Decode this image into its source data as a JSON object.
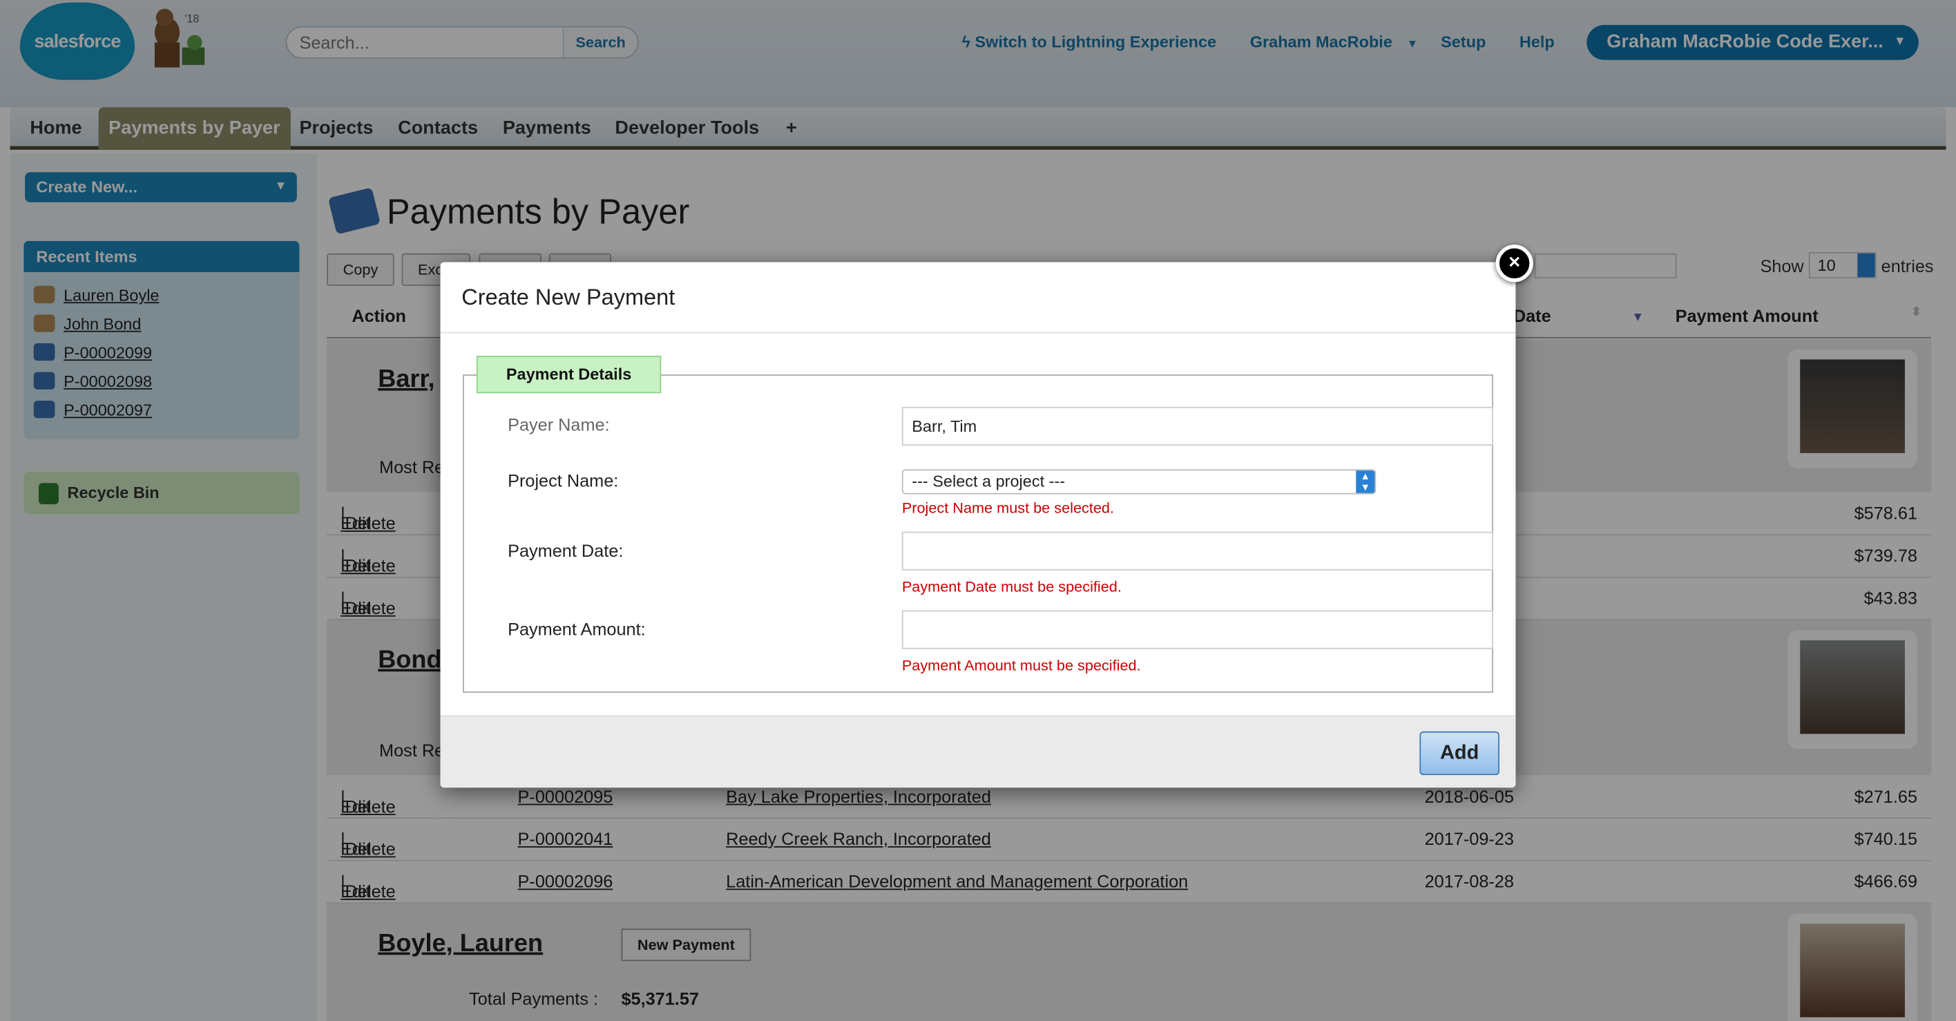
{
  "header": {
    "logo_text": "salesforce",
    "badge": "'18",
    "search_placeholder": "Search...",
    "search_button": "Search",
    "lightning_link": "Switch to Lightning Experience",
    "user_menu": "Graham MacRobie",
    "setup": "Setup",
    "help": "Help",
    "org_button": "Graham MacRobie Code Exer..."
  },
  "tabs": [
    "Home",
    "Payments by Payer",
    "Projects",
    "Contacts",
    "Payments",
    "Developer Tools",
    "+"
  ],
  "sidebar": {
    "create_new": "Create New...",
    "recent_title": "Recent Items",
    "recent_items": [
      "Lauren Boyle",
      "John Bond",
      "P-00002099",
      "P-00002098",
      "P-00002097"
    ],
    "recycle_bin": "Recycle Bin"
  },
  "page": {
    "title": "Payments by Payer",
    "buttons": [
      "Copy",
      "Exc",
      "",
      ""
    ],
    "show_label": "Show",
    "show_value": "10",
    "entries_label": "entries",
    "col_action": "Action",
    "col_date": "Date",
    "col_amount": "Payment Amount"
  },
  "groups": {
    "barr": {
      "name": "Barr,",
      "most_recent": "Most Re",
      "rows": [
        {
          "edit": "Edit",
          "delete": "Delete",
          "amount": "$578.61"
        },
        {
          "edit": "Edit",
          "delete": "Delete",
          "amount": "$739.78"
        },
        {
          "edit": "Edit",
          "delete": "Delete",
          "amount": "$43.83"
        }
      ]
    },
    "bond": {
      "name": "Bond",
      "most_recent": "Most Re",
      "rows": [
        {
          "edit": "Edit",
          "delete": "Delete",
          "id": "P-00002095",
          "project": "Bay Lake Properties, Incorporated",
          "date": "2018-06-05",
          "amount": "$271.65"
        },
        {
          "edit": "Edit",
          "delete": "Delete",
          "id": "P-00002041",
          "project": "Reedy Creek Ranch, Incorporated",
          "date": "2017-09-23",
          "amount": "$740.15"
        },
        {
          "edit": "Edit",
          "delete": "Delete",
          "id": "P-00002096",
          "project": "Latin-American Development and Management Corporation",
          "date": "2017-08-28",
          "amount": "$466.69"
        }
      ]
    },
    "boyle": {
      "name": "Boyle, Lauren",
      "new_payment": "New Payment",
      "total_label": "Total Payments :",
      "total_value": "$5,371.57"
    }
  },
  "modal": {
    "title": "Create New Payment",
    "legend": "Payment Details",
    "payer_label": "Payer Name:",
    "payer_value": "Barr, Tim",
    "project_label": "Project Name:",
    "project_value": "--- Select a project ---",
    "project_error": "Project Name must be selected.",
    "date_label": "Payment Date:",
    "date_error": "Payment Date must be specified.",
    "amount_label": "Payment Amount:",
    "amount_error": "Payment Amount must be specified.",
    "add_button": "Add",
    "close_icon": "×"
  },
  "colors": {
    "brand_blue": "#1798c1",
    "active_tab": "#8d8d6a",
    "error": "#cc0000",
    "legend_green": "#c8f2c4"
  }
}
